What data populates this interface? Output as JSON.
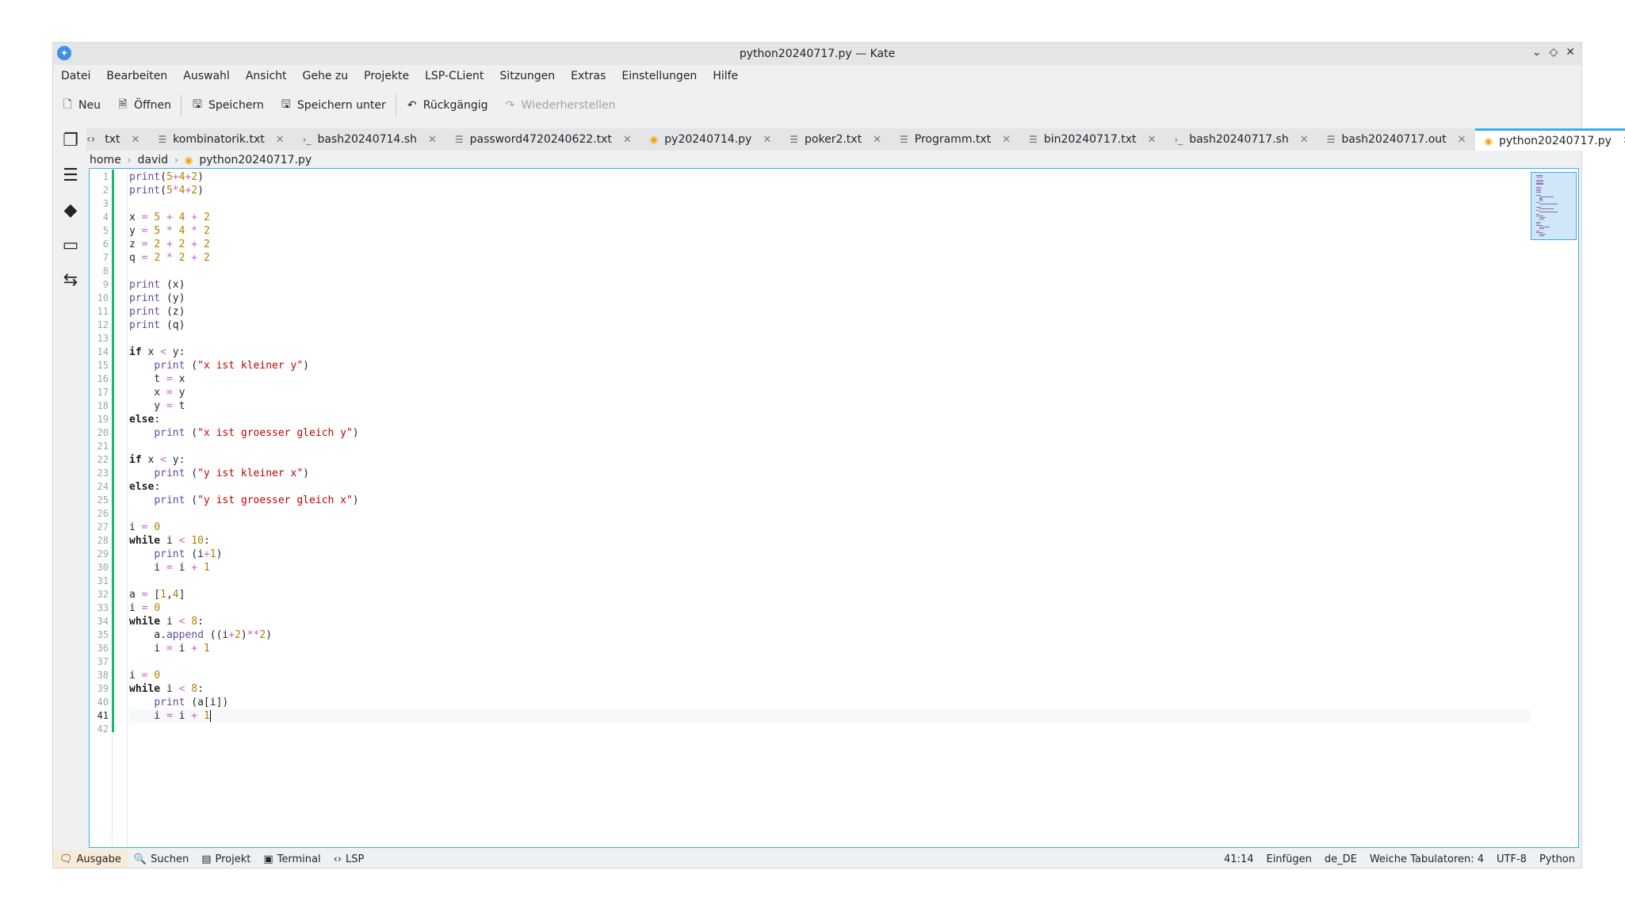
{
  "window": {
    "title": "python20240717.py — Kate",
    "controls": [
      "minimize-icon",
      "maximize-icon",
      "close-icon"
    ]
  },
  "menu": [
    "Datei",
    "Bearbeiten",
    "Auswahl",
    "Ansicht",
    "Gehe zu",
    "Projekte",
    "LSP-CLient",
    "Sitzungen",
    "Extras",
    "Einstellungen",
    "Hilfe"
  ],
  "toolbar": {
    "new": "Neu",
    "open": "Öffnen",
    "save": "Speichern",
    "save_as": "Speichern unter",
    "undo": "Rückgängig",
    "redo": "Wiederherstellen"
  },
  "tabs": [
    {
      "label": "txt",
      "icon": "text-file-icon"
    },
    {
      "label": "kombinatorik.txt",
      "icon": "text-file-icon"
    },
    {
      "label": "bash20240714.sh",
      "icon": "shell-file-icon"
    },
    {
      "label": "password4720240622.txt",
      "icon": "text-file-icon"
    },
    {
      "label": "py20240714.py",
      "icon": "python-file-icon"
    },
    {
      "label": "poker2.txt",
      "icon": "text-file-icon"
    },
    {
      "label": "Programm.txt",
      "icon": "text-file-icon"
    },
    {
      "label": "bin20240717.txt",
      "icon": "text-file-icon"
    },
    {
      "label": "bash20240717.sh",
      "icon": "shell-file-icon"
    },
    {
      "label": "bash20240717.out",
      "icon": "text-file-icon"
    },
    {
      "label": "python20240717.py",
      "icon": "python-file-icon",
      "active": true
    }
  ],
  "breadcrumb": {
    "home": "home",
    "user": "david",
    "file": "python20240717.py"
  },
  "code": {
    "current_line": 41,
    "lines": [
      "print(5+4+2)",
      "print(5*4+2)",
      "",
      "x = 5 + 4 + 2",
      "y = 5 * 4 * 2",
      "z = 2 + 2 + 2",
      "q = 2 * 2 + 2",
      "",
      "print (x)",
      "print (y)",
      "print (z)",
      "print (q)",
      "",
      "if x < y:",
      "    print (\"x ist kleiner y\")",
      "    t = x",
      "    x = y",
      "    y = t",
      "else:",
      "    print (\"x ist groesser gleich y\")",
      "",
      "if x < y:",
      "    print (\"y ist kleiner x\")",
      "else:",
      "    print (\"y ist groesser gleich x\")",
      "",
      "i = 0",
      "while i < 10:",
      "    print (i+1)",
      "    i = i + 1",
      "",
      "a = [1,4]",
      "i = 0",
      "while i < 8:",
      "    a.append ((i+2)**2)",
      "    i = i + 1",
      "",
      "i = 0",
      "while i < 8:",
      "    print (a[i])",
      "    i = i + 1",
      ""
    ]
  },
  "statusbar": {
    "output": "Ausgabe",
    "search": "Suchen",
    "project": "Projekt",
    "terminal": "Terminal",
    "lsp": "LSP",
    "cursor": "41:14",
    "mode": "Einfügen",
    "language_dict": "de_DE",
    "indent": "Weiche Tabulatoren: 4",
    "encoding": "UTF-8",
    "syntax": "Python"
  }
}
